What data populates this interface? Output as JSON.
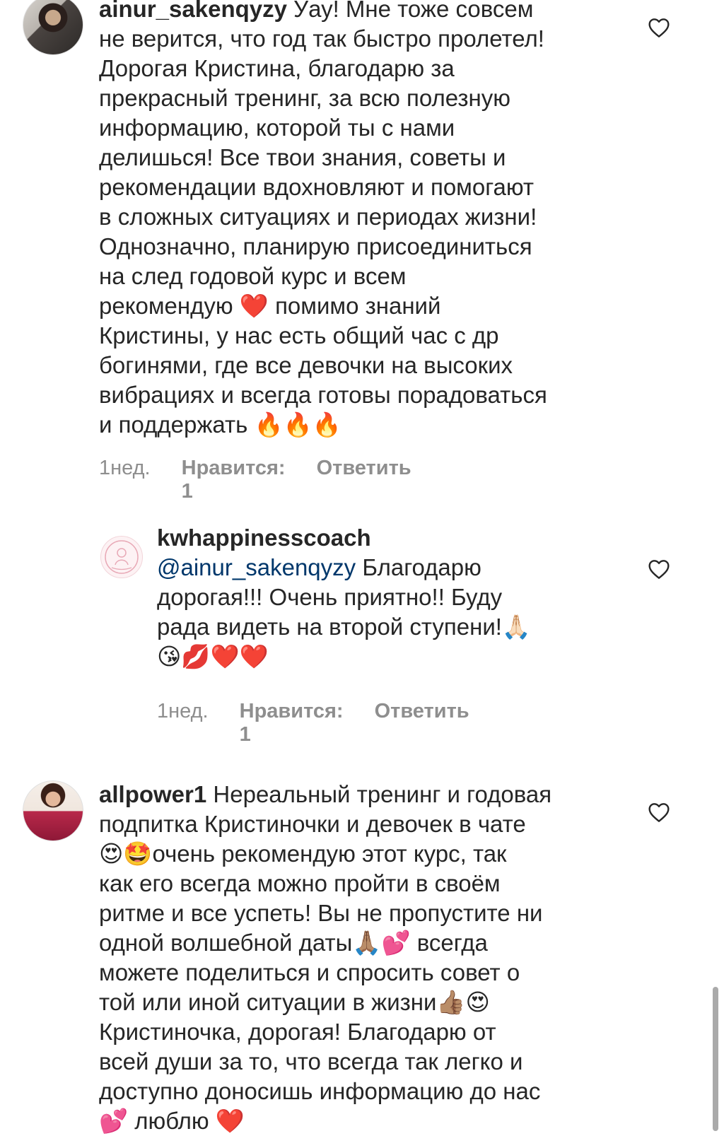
{
  "comments": [
    {
      "username": "ainur_sakenqyzy",
      "text_first": " Уау! Мне тоже совсем",
      "text_rest": "не верится, что год так быстро пролетел!\nДорогая Кристина, благодарю за\nпрекрасный тренинг, за всю полезную\nинформацию, которой ты с нами\nделишься! Все твои знания, советы и\nрекомендации  вдохновляют и помогают\nв сложных ситуациях и периодах жизни!\nОднозначно, планирую присоединиться\nна след годовой курс и всем\nрекомендую ❤️ помимо знаний\nКристины, у нас есть общий час с др\nбогинями, где все девочки на высоких\nвибрациях и всегда готовы порадоваться\nи поддержать 🔥🔥🔥",
      "time": "1нед.",
      "likes": "Нравится: 1",
      "reply": "Ответить"
    },
    {
      "username": "kwhappinesscoach",
      "mention": "@ainur_sakenqyzy",
      "text_first": " Благодарю",
      "text_rest": "дорогая!!! Очень приятно!! Буду\nрада видеть на второй ступени!🙏🏻\n😘💋❤️❤️",
      "time": "1нед.",
      "likes": "Нравится: 1",
      "reply": "Ответить"
    },
    {
      "username": "allpower1",
      "text_first": " Нереальный тренинг и годовая",
      "text_rest": "подпитка Кристиночки и девочек в чате\n😍🤩очень рекомендую этот курс, так\nкак его всегда можно пройти в своём\nритме и все успеть! Вы не пропустите ни\nодной волшебной даты🙏🏽💕  всегда\nможете поделиться и спросить совет о\nтой или иной ситуации в жизни👍🏽😍\nКристиночка, дорогая! Благодарю от\nвсей души за то, что всегда так легко и\nдоступно доносишь информацию до нас\n💕 люблю ❤️"
    }
  ],
  "icons": {
    "like": "heart-outline-icon"
  },
  "colors": {
    "text": "#262626",
    "muted": "#8e8e8e",
    "mention": "#00376b"
  }
}
